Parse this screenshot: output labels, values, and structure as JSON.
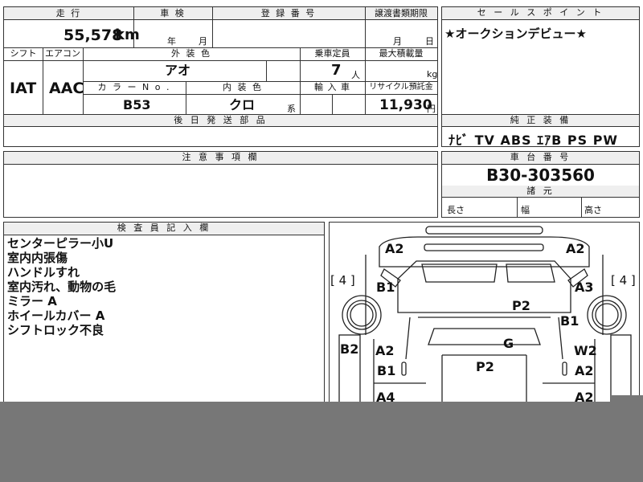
{
  "header": {
    "mileage_label": "走 行",
    "inspection_label": "車 検",
    "reg_number_label": "登 録 番 号",
    "transfer_label": "譲渡書類期限",
    "sales_point_label": "セ ー ル ス ポ イ ン ト"
  },
  "mileage": {
    "value": "55,578",
    "unit": "km"
  },
  "inspection": {
    "year_unit": "年",
    "month_unit": "月"
  },
  "transfer": {
    "month_unit": "月",
    "day_unit": "日"
  },
  "labels": {
    "shift": "シフト",
    "aircon": "エアコン",
    "exterior_color": "外 装 色",
    "capacity": "乗車定員",
    "max_load": "最大積載量",
    "color_no": "カ ラ ー N o .",
    "interior_color": "内 装 色",
    "import": "輸 入 車",
    "recycle": "リサイクル預託金",
    "post_delivery": "後 日 発 送 部 品",
    "equipment": "純 正 装 備",
    "caution": "注 意 事 項 欄",
    "chassis": "車 台 番 号",
    "dimensions": "諸 元",
    "length": "長さ",
    "width": "幅",
    "height": "高さ",
    "inspector": "検 査 員 記 入 欄"
  },
  "vehicle": {
    "shift": "IAT",
    "aircon": "AAC",
    "exterior_color": "アオ",
    "capacity": "7",
    "capacity_unit": "人",
    "load_unit": "kg",
    "color_no": "B53",
    "interior_color": "クロ",
    "interior_suffix": "系",
    "recycle_fee": "11,930",
    "recycle_unit": "円"
  },
  "sales_point": "★オークションデビュー★",
  "equipment": "ﾅﾋﾞ TV ABS ｴｱB PS PW",
  "chassis_number": "B30-303560",
  "inspector_notes": [
    "センターピラー小U",
    "室内内張傷",
    "ハンドルすれ",
    "室内汚れ、動物の毛",
    "ミラー A",
    "ホイールカバー A",
    "シフトロック不良"
  ],
  "diagram": {
    "tire_left": "[ 4 ]",
    "tire_right": "[ 4 ]",
    "marks": [
      "A2",
      "A2",
      "B1",
      "A3",
      "P2",
      "B1",
      "B2",
      "G",
      "A2",
      "W2",
      "B1",
      "P2",
      "A2",
      "A4",
      "A2"
    ]
  }
}
